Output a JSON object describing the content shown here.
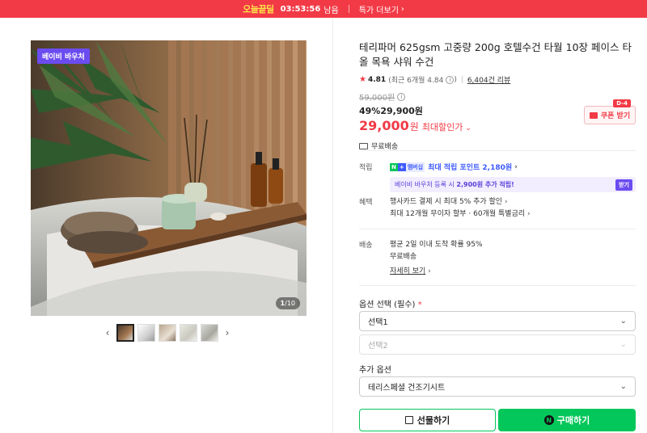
{
  "banner": {
    "logo": "오늘끝딜",
    "timer": "03:53:56",
    "remaining": "남음",
    "more": "특가 더보기",
    "bg_color": "#f23a46"
  },
  "gallery": {
    "badge": "베이비 바우처",
    "counter_current": "1",
    "counter_total": "/10",
    "prev_icon": "chevron-left-icon",
    "next_icon": "chevron-right-icon",
    "thumbnail_count": 5
  },
  "product": {
    "title": "테리파머 625gsm 고중량 200g 호텔수건 타월 10장 페이스 타올 목욕 샤워 수건",
    "rating": "4.81",
    "recent_rating": "(최근 6개월 4.84",
    "recent_rating_close": ")",
    "reviews": "6,404건 리뷰",
    "original_price": "59,000원",
    "discount_pct": "49%",
    "discount_price": "29,900원",
    "final_price": "29,000",
    "final_won": "원",
    "max_discount_label": "최대할인가",
    "shipping": "무료배송",
    "coupon_label": "쿠폰 받기",
    "coupon_dday": "D-4"
  },
  "points": {
    "label": "적립",
    "np_n": "N",
    "np_plus": "+",
    "np_member": "멤버십",
    "text": "최대 적립 포인트 2,180원",
    "baby_text_pre": "베이비 바우처 등록 시 ",
    "baby_text_bold": "2,900원 추가 적립!",
    "baby_button": "받기"
  },
  "benefits": {
    "label": "혜택",
    "line1": "행사카드 결제 시 최대 5% 추가 할인",
    "line2": "최대 12개월 무이자 할부 · 60개월 특별금리"
  },
  "delivery": {
    "label": "배송",
    "line1": "평균 2일 이내 도착 확률 95%",
    "line2": "무료배송",
    "detail_link": "자세히 보기"
  },
  "options": {
    "title": "옵션 선택 (필수)",
    "required_mark": "*",
    "select1": "선택1",
    "select2": "선택2",
    "extra_title": "추가 옵션",
    "extra_select": "테리스페셜 건조기시트"
  },
  "actions": {
    "gift": "선물하기",
    "buy": "구매하기",
    "npay_mark": "N",
    "accent": "#03c75a"
  }
}
